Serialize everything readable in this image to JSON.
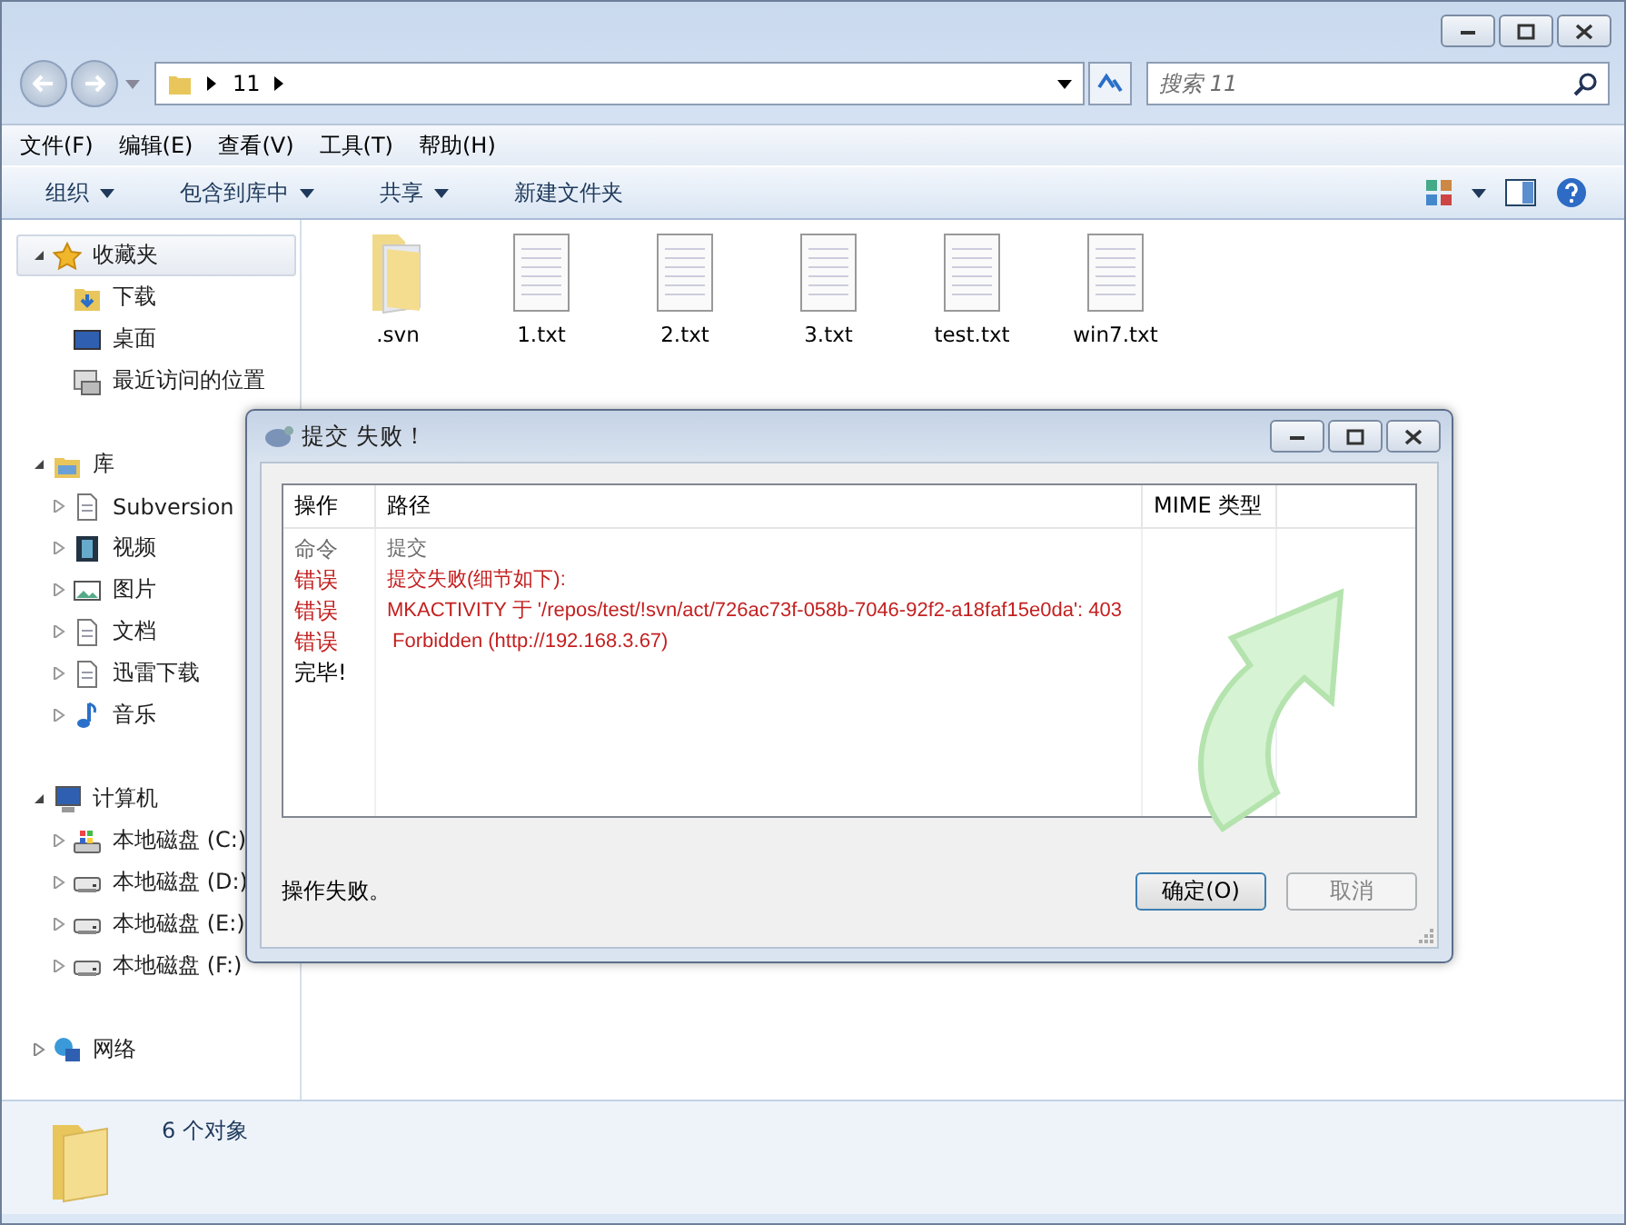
{
  "address": {
    "crumbs": [
      "11"
    ]
  },
  "search": {
    "placeholder": "搜索 11"
  },
  "menu": [
    "文件(F)",
    "编辑(E)",
    "查看(V)",
    "工具(T)",
    "帮助(H)"
  ],
  "toolbar": [
    {
      "label": "组织",
      "dropdown": true
    },
    {
      "label": "包含到库中",
      "dropdown": true
    },
    {
      "label": "共享",
      "dropdown": true
    },
    {
      "label": "新建文件夹",
      "dropdown": false
    }
  ],
  "sidebar": [
    {
      "label": "收藏夹",
      "kind": "star",
      "expanded": true,
      "children": [
        {
          "label": "下载",
          "kind": "download",
          "expandable": false
        },
        {
          "label": "桌面",
          "kind": "desktop",
          "expandable": false
        },
        {
          "label": "最近访问的位置",
          "kind": "recent",
          "expandable": false
        }
      ]
    },
    {
      "label": "库",
      "kind": "library",
      "expanded": true,
      "children": [
        {
          "label": "Subversion",
          "kind": "doc",
          "expandable": true
        },
        {
          "label": "视频",
          "kind": "video",
          "expandable": true
        },
        {
          "label": "图片",
          "kind": "image",
          "expandable": true
        },
        {
          "label": "文档",
          "kind": "doc",
          "expandable": true
        },
        {
          "label": "迅雷下载",
          "kind": "doc",
          "expandable": true
        },
        {
          "label": "音乐",
          "kind": "music",
          "expandable": true
        }
      ]
    },
    {
      "label": "计算机",
      "kind": "computer",
      "expanded": true,
      "children": [
        {
          "label": "本地磁盘 (C:)",
          "kind": "sysdrive",
          "expandable": true
        },
        {
          "label": "本地磁盘 (D:)",
          "kind": "drive",
          "expandable": true
        },
        {
          "label": "本地磁盘 (E:)",
          "kind": "drive",
          "expandable": true
        },
        {
          "label": "本地磁盘 (F:)",
          "kind": "drive",
          "expandable": true
        }
      ]
    },
    {
      "label": "网络",
      "kind": "network",
      "expanded": false
    }
  ],
  "files": [
    {
      "name": ".svn",
      "kind": "folder"
    },
    {
      "name": "1.txt",
      "kind": "text"
    },
    {
      "name": "2.txt",
      "kind": "text"
    },
    {
      "name": "3.txt",
      "kind": "text"
    },
    {
      "name": "test.txt",
      "kind": "text"
    },
    {
      "name": "win7.txt",
      "kind": "text"
    }
  ],
  "status": "6 个对象",
  "dialog": {
    "title": "提交 失败！",
    "columns": [
      "操作",
      "路径",
      "MIME 类型"
    ],
    "rows": [
      {
        "action": "命令",
        "path": "提交",
        "kind": "command"
      },
      {
        "action": "错误",
        "path": "提交失败(细节如下):",
        "kind": "error"
      },
      {
        "action": "错误",
        "path": "MKACTIVITY 于 '/repos/test/!svn/act/726ac73f-058b-7046-92f2-a18faf15e0da': 403",
        "kind": "error"
      },
      {
        "action": "错误",
        "path": " Forbidden (http://192.168.3.67)",
        "kind": "error"
      },
      {
        "action": "完毕!",
        "kind": "done"
      }
    ],
    "message": "操作失败。",
    "buttons": [
      {
        "label": "确定(O)",
        "disabled": false
      },
      {
        "label": "取消",
        "disabled": true
      }
    ]
  }
}
